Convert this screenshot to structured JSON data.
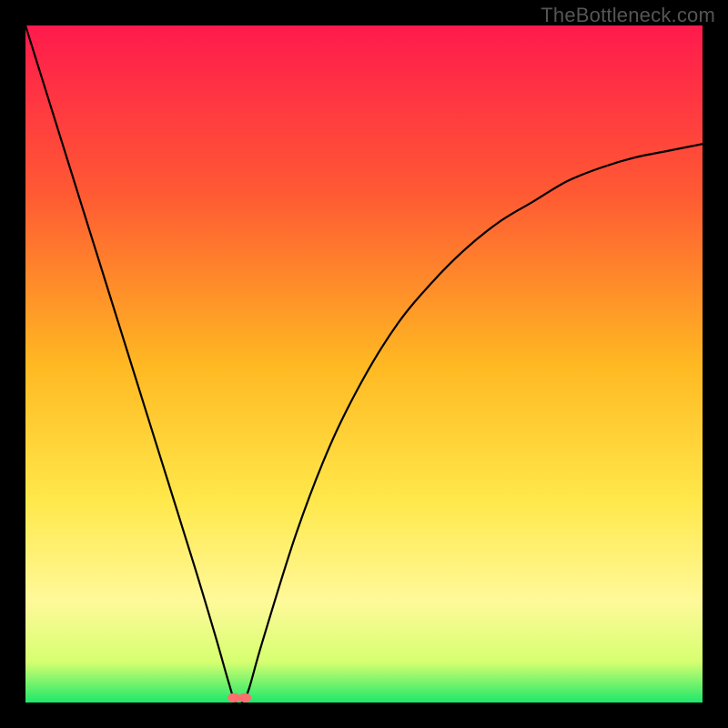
{
  "watermark": "TheBottleneck.com",
  "chart_data": {
    "type": "line",
    "title": "",
    "xlabel": "",
    "ylabel": "",
    "xlim": [
      0,
      100
    ],
    "ylim": [
      0,
      100
    ],
    "grid": false,
    "legend": false,
    "background_gradient": {
      "stops": [
        {
          "offset": 0,
          "color": "#ff1a4d"
        },
        {
          "offset": 25,
          "color": "#ff5a33"
        },
        {
          "offset": 50,
          "color": "#ffb822"
        },
        {
          "offset": 70,
          "color": "#ffe84a"
        },
        {
          "offset": 85,
          "color": "#fff99a"
        },
        {
          "offset": 94,
          "color": "#d6ff70"
        },
        {
          "offset": 100,
          "color": "#1ee86a"
        }
      ]
    },
    "series": [
      {
        "name": "bottleneck-curve",
        "color": "#000000",
        "x": [
          0,
          5,
          10,
          15,
          20,
          25,
          28,
          30,
          31,
          32,
          33,
          35,
          40,
          45,
          50,
          55,
          60,
          65,
          70,
          75,
          80,
          85,
          90,
          95,
          100
        ],
        "y": [
          100,
          84,
          68,
          52,
          36,
          20,
          10,
          3,
          0,
          0,
          2,
          9,
          25,
          38,
          48,
          56,
          62,
          67,
          71,
          74,
          77,
          79,
          80.5,
          81.5,
          82.5
        ]
      }
    ],
    "markers": [
      {
        "name": "min-marker-a",
        "x": 30.8,
        "y": 0.7,
        "color": "#ff6f6f"
      },
      {
        "name": "min-marker-b",
        "x": 32.4,
        "y": 0.7,
        "color": "#ff6f6f"
      }
    ]
  }
}
